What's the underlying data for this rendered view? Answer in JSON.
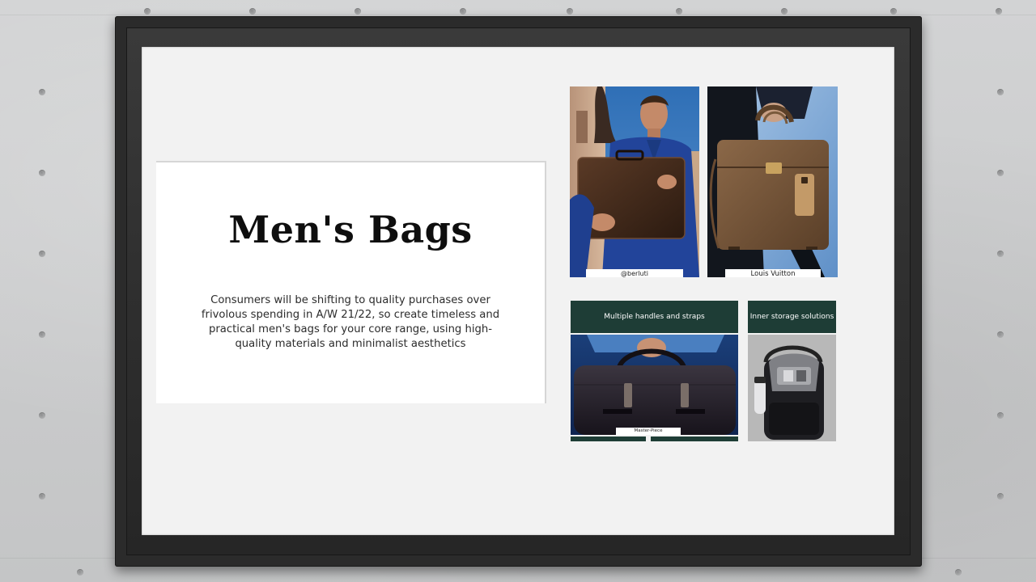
{
  "slide": {
    "title": "Men's Bags",
    "description": "Consumers will be shifting to quality purchases over frivolous spending in A/W 21/22, so create timeless and practical men's bags for your core range, using high-quality materials and minimalist aesthetics"
  },
  "photos": [
    {
      "caption": "@berluti",
      "depicts": "man in blue suit holding dark brown briefcase"
    },
    {
      "caption": "Louis Vuitton",
      "depicts": "hand holding brown leather briefcase with tag"
    },
    {
      "caption": "Master-Piece",
      "label": "Multiple handles and straps",
      "depicts": "hand holding black travel bag"
    },
    {
      "caption": "",
      "label": "Inner storage solutions",
      "depicts": "open black backpack with bottle"
    }
  ],
  "colors": {
    "wall": "#c9cacb",
    "frame": "#2b2b2b",
    "canvas": "#f2f2f2",
    "card": "#ffffff",
    "label_green": "#1e3d36"
  }
}
